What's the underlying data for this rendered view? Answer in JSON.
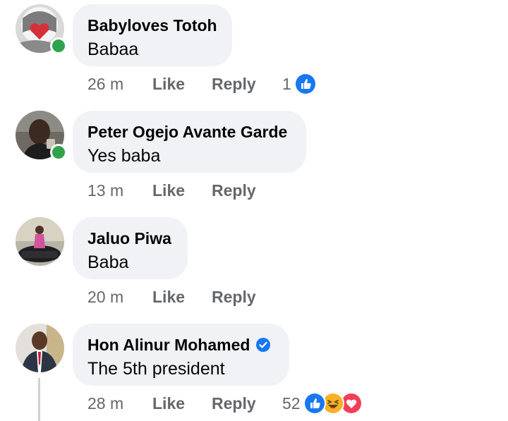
{
  "comments": [
    {
      "author": "Babyloves Totoh",
      "text": "Babaa",
      "time": "26 m",
      "like_label": "Like",
      "reply_label": "Reply",
      "reaction_count": "1",
      "reactions": [
        "like-icon"
      ],
      "online": true,
      "verified": false
    },
    {
      "author": "Peter Ogejo Avante Garde",
      "text": "Yes baba",
      "time": "13 m",
      "like_label": "Like",
      "reply_label": "Reply",
      "reaction_count": "",
      "reactions": [],
      "online": true,
      "verified": false
    },
    {
      "author": "Jaluo Piwa",
      "text": "Baba",
      "time": "20 m",
      "like_label": "Like",
      "reply_label": "Reply",
      "reaction_count": "",
      "reactions": [],
      "online": false,
      "verified": false
    },
    {
      "author": "Hon Alinur Mohamed",
      "text": "The 5th president",
      "time": "28 m",
      "like_label": "Like",
      "reply_label": "Reply",
      "reaction_count": "52",
      "reactions": [
        "like-icon",
        "haha-icon",
        "love-icon"
      ],
      "online": false,
      "verified": true
    }
  ],
  "colors": {
    "bubble": "#f0f2f5",
    "meta_text": "#65676b",
    "online": "#31a24c",
    "like_blue": "#1877f2",
    "love_red": "#f33e58",
    "haha_yellow": "#f7b125"
  }
}
